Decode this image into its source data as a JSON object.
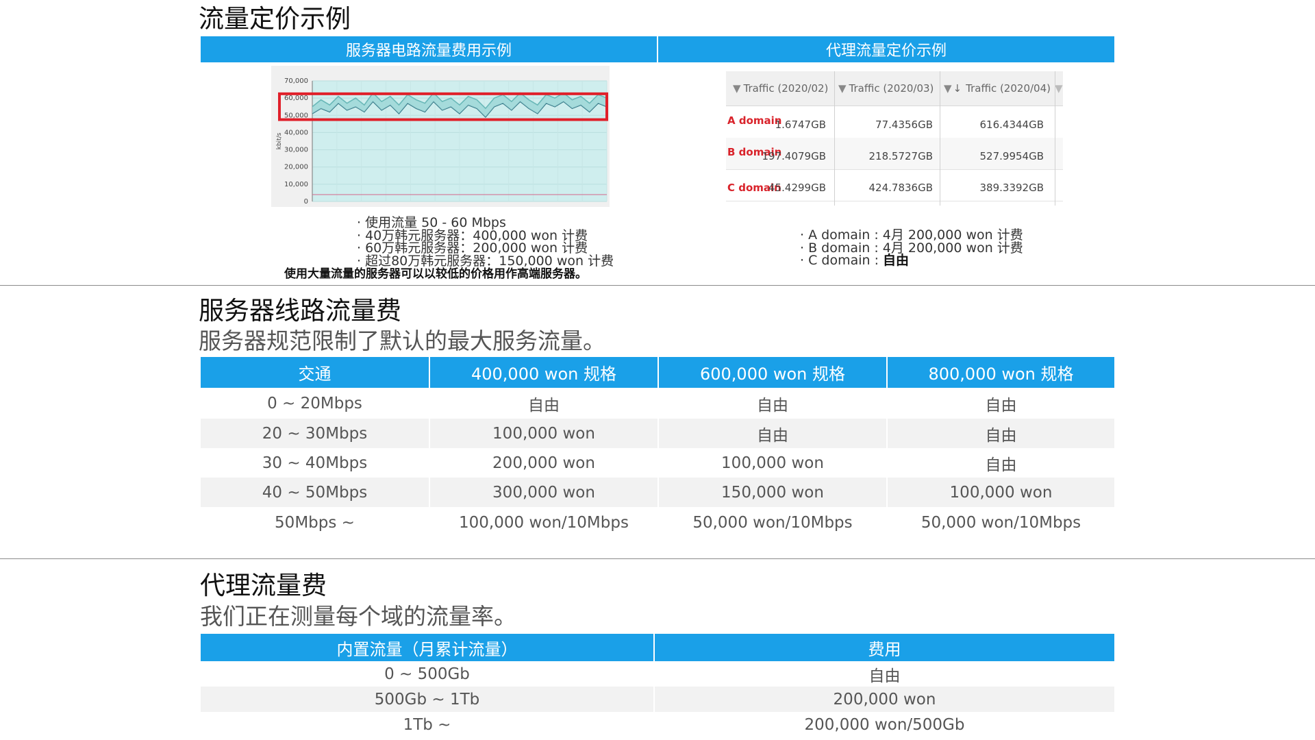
{
  "section1": {
    "title": "流量定价示例",
    "left_header": "服务器电路流量费用示例",
    "right_header": "代理流量定价示例",
    "chart_data": {
      "type": "area",
      "ylabel": "kbit/s",
      "yticks": [
        "70,000",
        "60,000",
        "50,000",
        "40,000",
        "30,000",
        "20,000",
        "10,000",
        "0"
      ],
      "ylim": [
        0,
        70000
      ],
      "grid": true,
      "series": [
        {
          "values": [
            51000,
            54000,
            52000,
            57000,
            53000,
            55000,
            52000,
            58000,
            53000,
            56000,
            51000,
            57000,
            54000,
            52000,
            58000,
            53000,
            55000,
            51000,
            56000,
            54000,
            49000,
            55000,
            57000,
            53000,
            58000,
            54000,
            51000,
            57000,
            55000,
            58000,
            54000,
            56000,
            52000,
            57000,
            55000
          ]
        },
        {
          "values": [
            55000,
            59000,
            56000,
            61000,
            57000,
            60000,
            56000,
            63000,
            58000,
            61000,
            56000,
            62000,
            59000,
            57000,
            63000,
            58000,
            60000,
            56000,
            61000,
            59000,
            54000,
            60000,
            62000,
            58000,
            63000,
            59000,
            56000,
            62000,
            60000,
            63000,
            59000,
            61000,
            57000,
            62000,
            60000
          ]
        },
        {
          "values": [
            4000,
            4000,
            4000,
            4000,
            4000,
            4000,
            4000,
            4000,
            4000,
            4000,
            4000,
            4000,
            4000,
            4000,
            4000,
            4000,
            4000,
            4000,
            4000,
            4000,
            4000,
            4000,
            4000,
            4000,
            4000,
            4000,
            4000,
            4000,
            4000,
            4000,
            4000,
            4000,
            4000,
            4000,
            4000
          ]
        }
      ],
      "highlight_range": [
        50000,
        60000
      ],
      "highlight_color": "#e0202a",
      "fill_color": "#cfeeee",
      "line_color": "#2c6e7f"
    },
    "left_notes": [
      "· 使用流量 50 - 60 Mbps",
      "· 40万韩元服务器：400,000 won 计费",
      "· 60万韩元服务器：200,000 won 计费",
      "· 超过80万韩元服务器：150,000 won 计费"
    ],
    "left_note_bold": "使用大量流量的服务器可以以较低的价格用作高端服务器。",
    "domain_table": {
      "headers": [
        "Traffic (2020/02)",
        "Traffic (2020/03)",
        "Traffic (2020/04)"
      ],
      "rows": [
        {
          "name": "A domain",
          "values": [
            "1.6747GB",
            "77.4356GB",
            "616.4344GB"
          ]
        },
        {
          "name": "B domain",
          "values": [
            "197.4079GB",
            "218.5727GB",
            "527.9954GB"
          ]
        },
        {
          "name": "C domain",
          "values": [
            "45.4299GB",
            "424.7836GB",
            "389.3392GB"
          ]
        }
      ]
    },
    "right_notes": [
      "· A domain : 4月 200,000 won 计费",
      "· B domain : 4月 200,000 won 计费"
    ],
    "right_note_c_prefix": "· C domain : ",
    "right_note_c_value": "自由"
  },
  "section2": {
    "title": "服务器线路流量费",
    "subtitle": "服务器规范限制了默认的最大服务流量。",
    "headers": [
      "交通",
      "400,000 won 规格",
      "600,000 won 规格",
      "800,000 won 规格"
    ],
    "rows": [
      [
        "0 ~ 20Mbps",
        "自由",
        "自由",
        "自由"
      ],
      [
        "20 ~ 30Mbps",
        "100,000 won",
        "自由",
        "自由"
      ],
      [
        "30 ~ 40Mbps",
        "200,000 won",
        "100,000 won",
        "自由"
      ],
      [
        "40 ~ 50Mbps",
        "300,000 won",
        "150,000 won",
        "100,000 won"
      ],
      [
        "50Mbps ~",
        "100,000 won/10Mbps",
        "50,000 won/10Mbps",
        "50,000 won/10Mbps"
      ]
    ]
  },
  "section3": {
    "title": "代理流量费",
    "subtitle": "我们正在测量每个域的流量率。",
    "headers": [
      "内置流量（月累计流量）",
      "费用"
    ],
    "rows": [
      [
        "0 ~ 500Gb",
        "自由"
      ],
      [
        "500Gb ~ 1Tb",
        "200,000 won"
      ],
      [
        "1Tb ~",
        "200,000 won/500Gb"
      ]
    ]
  }
}
